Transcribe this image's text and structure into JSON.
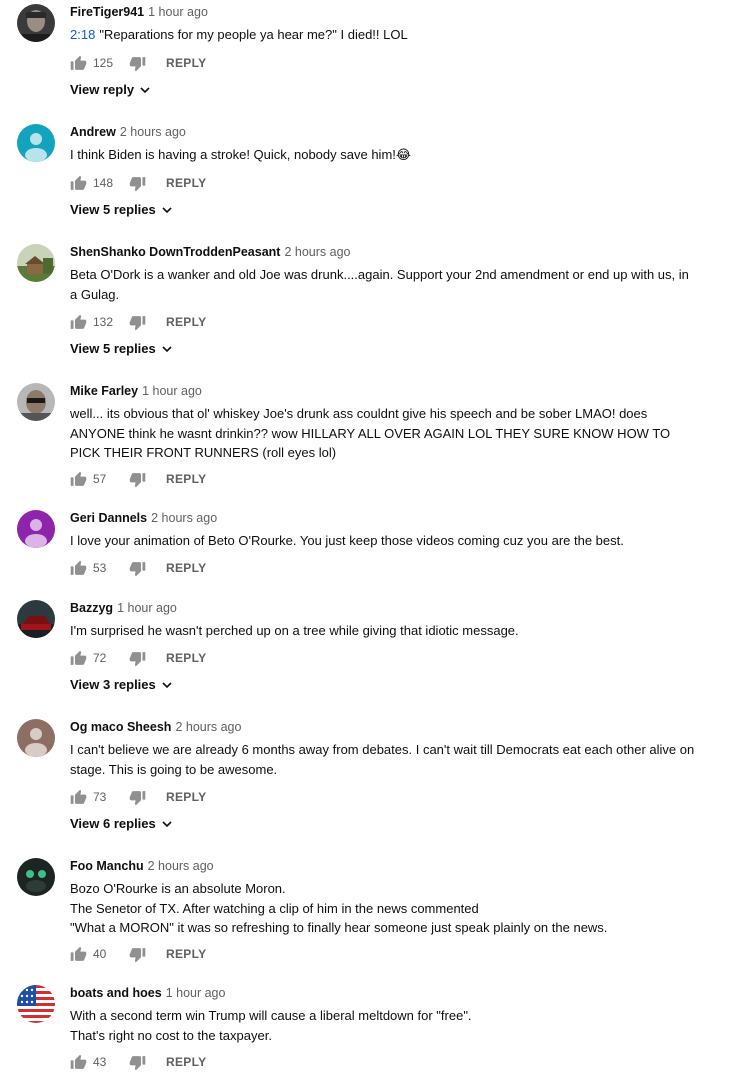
{
  "comments": [
    {
      "author": "FireTiger941",
      "time": "1 hour ago",
      "timestamp": "2:18",
      "text": "\"Reparations for my people ya hear me?\" I died!! LOL",
      "likes": "125",
      "reply_label": "REPLY",
      "view_replies": "View reply",
      "avatar_icon": "man-portrait-avatar"
    },
    {
      "author": "Andrew",
      "time": "2 hours ago",
      "text": "I think Biden is having a stroke! Quick, nobody save him!😂",
      "likes": "148",
      "reply_label": "REPLY",
      "view_replies": "View 5 replies",
      "avatar_icon": "default-user-avatar",
      "avatar_color": "#13a3bf"
    },
    {
      "author": "ShenShanko DownTroddenPeasant",
      "time": "2 hours ago",
      "text": "Beta O'Dork is a wanker and old Joe was drunk....again.  Support your 2nd amendment or end up with us, in a Gulag.",
      "likes": "132",
      "reply_label": "REPLY",
      "view_replies": "View 5 replies",
      "avatar_icon": "house-landscape-avatar"
    },
    {
      "author": "Mike Farley",
      "time": "1 hour ago",
      "text": "well... its obvious that ol' whiskey Joe's drunk ass couldnt give his speech and be sober LMAO! does ANYONE think he wasnt drinkin?? wow HILLARY ALL OVER AGAIN LOL THEY SURE KNOW HOW TO PICK THEIR FRONT RUNNERS (roll eyes lol)",
      "likes": "57",
      "reply_label": "REPLY",
      "avatar_icon": "man-sunglasses-avatar"
    },
    {
      "author": "Geri Dannels",
      "time": "2 hours ago",
      "text": "I love your animation of Beto O'Rourke. You just keep those videos coming cuz you are the best.",
      "likes": "53",
      "reply_label": "REPLY",
      "avatar_icon": "default-user-avatar",
      "avatar_color": "#8e24aa"
    },
    {
      "author": "Bazzyg",
      "time": "1 hour ago",
      "text": "I'm surprised he wasn't perched up on a tree while giving that idiotic message.",
      "likes": "72",
      "reply_label": "REPLY",
      "view_replies": "View 3 replies",
      "avatar_icon": "car-avatar"
    },
    {
      "author": "Og maco Sheesh",
      "time": "2 hours ago",
      "text": "I can't believe we are already 6 months away from debates. I can't wait till Democrats eat each other alive on stage. This is going to be awesome.",
      "likes": "73",
      "reply_label": "REPLY",
      "view_replies": "View 6 replies",
      "avatar_icon": "default-user-avatar",
      "avatar_color": "#8d6e63"
    },
    {
      "author": "Foo Manchu",
      "time": "2 hours ago",
      "text_lines": [
        "Bozo O'Rourke is an absolute Moron.",
        "The Senetor of TX. After watching a clip of him in the news commented",
        "\"What a MORON\" it was so refreshing to finally hear someone just speak plainly on the news."
      ],
      "likes": "40",
      "reply_label": "REPLY",
      "avatar_icon": "dark-creature-avatar"
    },
    {
      "author": "boats and hoes",
      "time": "1 hour ago",
      "text_lines": [
        "With a second term win Trump will cause a liberal meltdown for \"free\".",
        "That's right no cost to the taxpayer."
      ],
      "likes": "43",
      "reply_label": "REPLY",
      "avatar_icon": "us-flag-avatar"
    }
  ],
  "icons": {
    "like": "thumb-up-icon",
    "dislike": "thumb-down-icon",
    "expand": "chevron-down-icon"
  }
}
